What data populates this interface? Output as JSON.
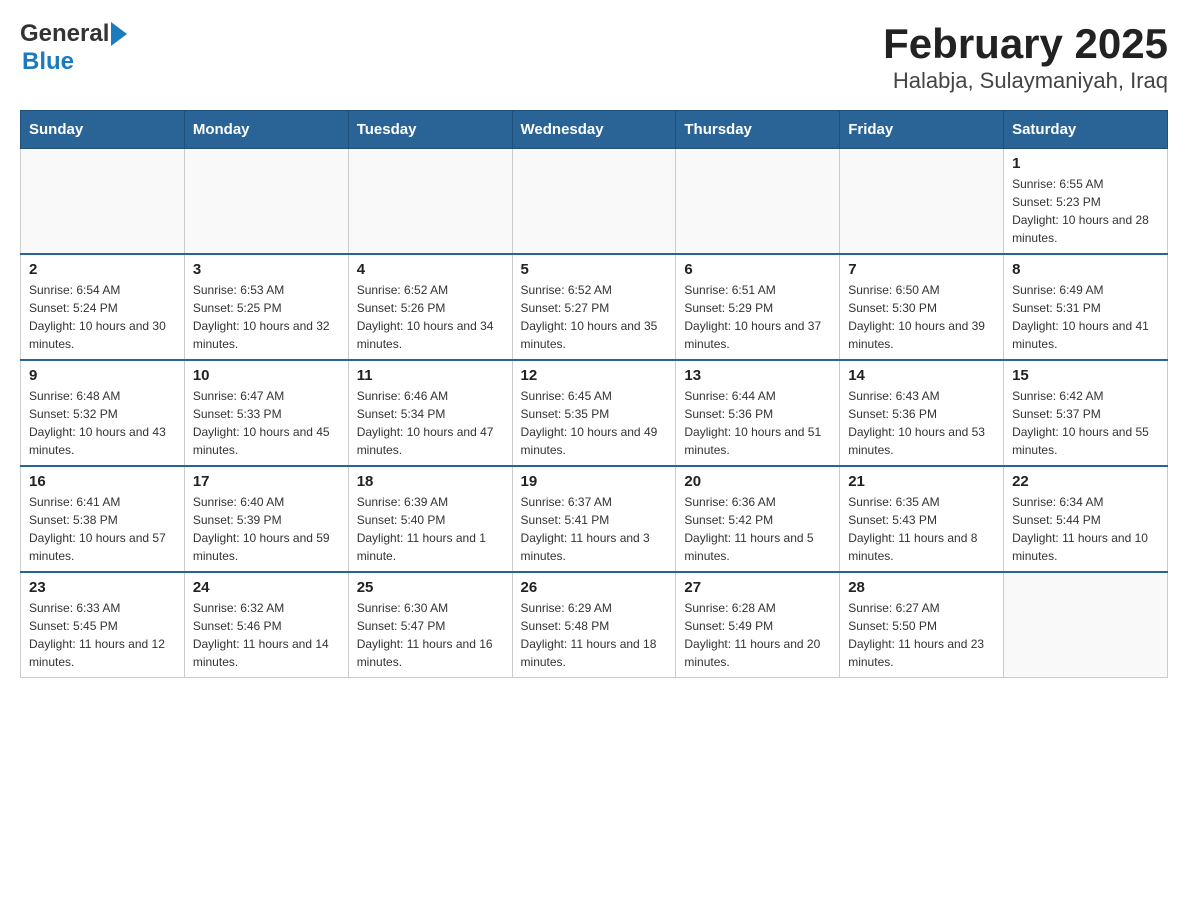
{
  "header": {
    "logo_general": "General",
    "logo_blue": "Blue",
    "title": "February 2025",
    "subtitle": "Halabja, Sulaymaniyah, Iraq"
  },
  "calendar": {
    "days_of_week": [
      "Sunday",
      "Monday",
      "Tuesday",
      "Wednesday",
      "Thursday",
      "Friday",
      "Saturday"
    ],
    "weeks": [
      [
        {
          "day": "",
          "info": ""
        },
        {
          "day": "",
          "info": ""
        },
        {
          "day": "",
          "info": ""
        },
        {
          "day": "",
          "info": ""
        },
        {
          "day": "",
          "info": ""
        },
        {
          "day": "",
          "info": ""
        },
        {
          "day": "1",
          "info": "Sunrise: 6:55 AM\nSunset: 5:23 PM\nDaylight: 10 hours and 28 minutes."
        }
      ],
      [
        {
          "day": "2",
          "info": "Sunrise: 6:54 AM\nSunset: 5:24 PM\nDaylight: 10 hours and 30 minutes."
        },
        {
          "day": "3",
          "info": "Sunrise: 6:53 AM\nSunset: 5:25 PM\nDaylight: 10 hours and 32 minutes."
        },
        {
          "day": "4",
          "info": "Sunrise: 6:52 AM\nSunset: 5:26 PM\nDaylight: 10 hours and 34 minutes."
        },
        {
          "day": "5",
          "info": "Sunrise: 6:52 AM\nSunset: 5:27 PM\nDaylight: 10 hours and 35 minutes."
        },
        {
          "day": "6",
          "info": "Sunrise: 6:51 AM\nSunset: 5:29 PM\nDaylight: 10 hours and 37 minutes."
        },
        {
          "day": "7",
          "info": "Sunrise: 6:50 AM\nSunset: 5:30 PM\nDaylight: 10 hours and 39 minutes."
        },
        {
          "day": "8",
          "info": "Sunrise: 6:49 AM\nSunset: 5:31 PM\nDaylight: 10 hours and 41 minutes."
        }
      ],
      [
        {
          "day": "9",
          "info": "Sunrise: 6:48 AM\nSunset: 5:32 PM\nDaylight: 10 hours and 43 minutes."
        },
        {
          "day": "10",
          "info": "Sunrise: 6:47 AM\nSunset: 5:33 PM\nDaylight: 10 hours and 45 minutes."
        },
        {
          "day": "11",
          "info": "Sunrise: 6:46 AM\nSunset: 5:34 PM\nDaylight: 10 hours and 47 minutes."
        },
        {
          "day": "12",
          "info": "Sunrise: 6:45 AM\nSunset: 5:35 PM\nDaylight: 10 hours and 49 minutes."
        },
        {
          "day": "13",
          "info": "Sunrise: 6:44 AM\nSunset: 5:36 PM\nDaylight: 10 hours and 51 minutes."
        },
        {
          "day": "14",
          "info": "Sunrise: 6:43 AM\nSunset: 5:36 PM\nDaylight: 10 hours and 53 minutes."
        },
        {
          "day": "15",
          "info": "Sunrise: 6:42 AM\nSunset: 5:37 PM\nDaylight: 10 hours and 55 minutes."
        }
      ],
      [
        {
          "day": "16",
          "info": "Sunrise: 6:41 AM\nSunset: 5:38 PM\nDaylight: 10 hours and 57 minutes."
        },
        {
          "day": "17",
          "info": "Sunrise: 6:40 AM\nSunset: 5:39 PM\nDaylight: 10 hours and 59 minutes."
        },
        {
          "day": "18",
          "info": "Sunrise: 6:39 AM\nSunset: 5:40 PM\nDaylight: 11 hours and 1 minute."
        },
        {
          "day": "19",
          "info": "Sunrise: 6:37 AM\nSunset: 5:41 PM\nDaylight: 11 hours and 3 minutes."
        },
        {
          "day": "20",
          "info": "Sunrise: 6:36 AM\nSunset: 5:42 PM\nDaylight: 11 hours and 5 minutes."
        },
        {
          "day": "21",
          "info": "Sunrise: 6:35 AM\nSunset: 5:43 PM\nDaylight: 11 hours and 8 minutes."
        },
        {
          "day": "22",
          "info": "Sunrise: 6:34 AM\nSunset: 5:44 PM\nDaylight: 11 hours and 10 minutes."
        }
      ],
      [
        {
          "day": "23",
          "info": "Sunrise: 6:33 AM\nSunset: 5:45 PM\nDaylight: 11 hours and 12 minutes."
        },
        {
          "day": "24",
          "info": "Sunrise: 6:32 AM\nSunset: 5:46 PM\nDaylight: 11 hours and 14 minutes."
        },
        {
          "day": "25",
          "info": "Sunrise: 6:30 AM\nSunset: 5:47 PM\nDaylight: 11 hours and 16 minutes."
        },
        {
          "day": "26",
          "info": "Sunrise: 6:29 AM\nSunset: 5:48 PM\nDaylight: 11 hours and 18 minutes."
        },
        {
          "day": "27",
          "info": "Sunrise: 6:28 AM\nSunset: 5:49 PM\nDaylight: 11 hours and 20 minutes."
        },
        {
          "day": "28",
          "info": "Sunrise: 6:27 AM\nSunset: 5:50 PM\nDaylight: 11 hours and 23 minutes."
        },
        {
          "day": "",
          "info": ""
        }
      ]
    ]
  }
}
